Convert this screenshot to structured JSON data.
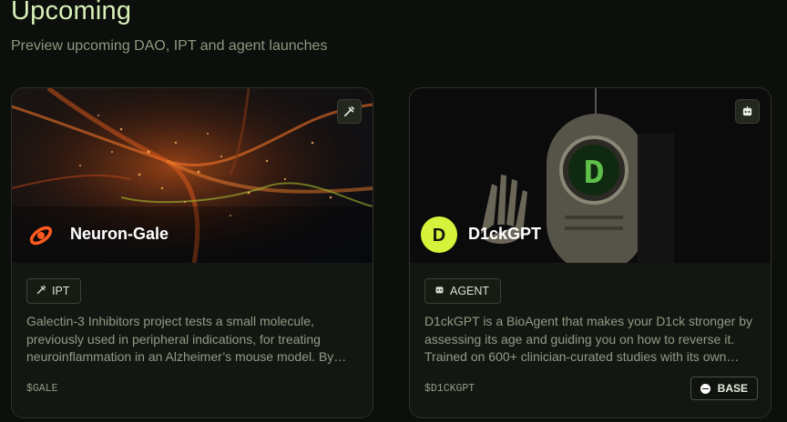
{
  "header": {
    "title": "Upcoming",
    "subtitle": "Preview upcoming DAO, IPT and agent launches"
  },
  "cards": [
    {
      "name": "Neuron-Gale",
      "corner_icon": "syringe-icon",
      "tag": {
        "label": "IPT",
        "icon": "syringe-icon"
      },
      "description": "Galectin-3 Inhibitors project tests a small molecule, previously used in peripheral indications, for treating neuroinflammation in an Alzheimer’s mouse model. By…",
      "ticker": "$GALE",
      "colors": {
        "accent": "#ff5a1f"
      }
    },
    {
      "name": "D1ckGPT",
      "corner_icon": "robot-icon",
      "tag": {
        "label": "AGENT",
        "icon": "robot-icon"
      },
      "description": "D1ckGPT is a BioAgent that makes your D1ck stronger by assessing its age and guiding you on how to reverse it. Trained on 600+ clinician-curated studies with its own…",
      "ticker": "$D1CKGPT",
      "chain": {
        "label": "BASE",
        "icon": "base-chain-icon"
      },
      "colors": {
        "accent": "#d6f23a"
      }
    }
  ]
}
